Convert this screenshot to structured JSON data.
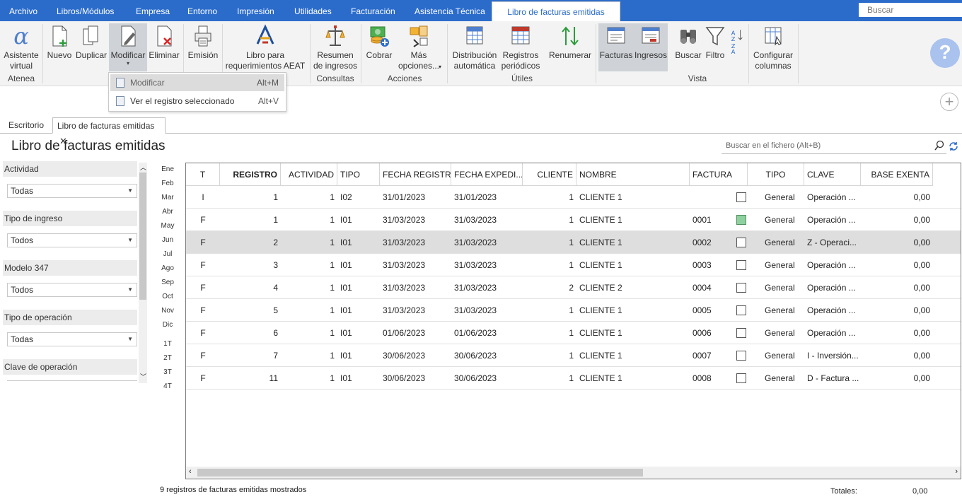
{
  "menubar": {
    "tabs": [
      "Archivo",
      "Libros/Módulos",
      "Empresa",
      "Entorno",
      "Impresión",
      "Utilidades",
      "Facturación",
      "Asistencia Técnica"
    ],
    "active_tab": "Libro de facturas emitidas",
    "search_placeholder": "Buscar"
  },
  "ribbon": {
    "buttons": {
      "asistente": "Asistente virtual",
      "nuevo": "Nuevo",
      "duplicar": "Duplicar",
      "modificar": "Modificar",
      "eliminar": "Eliminar",
      "emision": "Emisión",
      "libro": "Libro para requerimientos AEAT",
      "resumen": "Resumen de ingresos",
      "cobrar": "Cobrar",
      "mas": "Más opciones...",
      "distribucion": "Distribución automática",
      "registros": "Registros periódicos",
      "renumerar": "Renumerar",
      "facturas": "Facturas",
      "ingresos": "Ingresos",
      "buscar": "Buscar",
      "filtro": "Filtro",
      "configurar": "Configurar columnas"
    },
    "groups": {
      "atenea": "Atenea",
      "consultas": "Consultas",
      "acciones": "Acciones",
      "utiles": "Útiles",
      "vista": "Vista"
    }
  },
  "dropdown": {
    "items": [
      {
        "label": "Modificar",
        "shortcut": "Alt+M"
      },
      {
        "label": "Ver el registro seleccionado",
        "shortcut": "Alt+V"
      }
    ]
  },
  "doc_tabs": {
    "escritorio": "Escritorio",
    "libro": "Libro de facturas emitidas"
  },
  "page": {
    "title": "Libro de facturas emitidas",
    "search_placeholder": "Buscar en el fichero (Alt+B)"
  },
  "filters": [
    {
      "label": "Actividad",
      "value": "Todas"
    },
    {
      "label": "Tipo de ingreso",
      "value": "Todos"
    },
    {
      "label": "Modelo 347",
      "value": "Todos"
    },
    {
      "label": "Tipo de operación",
      "value": "Todas"
    },
    {
      "label": "Clave de operación",
      "value": ""
    }
  ],
  "months": [
    "Ene",
    "Feb",
    "Mar",
    "Abr",
    "May",
    "Jun",
    "Jul",
    "Ago",
    "Sep",
    "Oct",
    "Nov",
    "Dic"
  ],
  "quarters": [
    "1T",
    "2T",
    "3T",
    "4T"
  ],
  "table": {
    "headers": [
      "T",
      "REGISTRO",
      "ACTIVIDAD",
      "TIPO",
      "FECHA REGISTRO",
      "FECHA EXPEDI...",
      "CLIENTE",
      "NOMBRE",
      "FACTURA",
      "TIPO",
      "CLAVE",
      "BASE EXENTA"
    ],
    "rows": [
      {
        "t": "I",
        "registro": "1",
        "actividad": "1",
        "tipo": "I02",
        "fecha_reg": "31/01/2023",
        "fecha_exp": "31/01/2023",
        "cliente": "1",
        "nombre": "CLIENTE 1",
        "factura": "",
        "checked": false,
        "tipo2": "General",
        "clave": "Operación ...",
        "base": "0,00"
      },
      {
        "t": "F",
        "registro": "1",
        "actividad": "1",
        "tipo": "I01",
        "fecha_reg": "31/03/2023",
        "fecha_exp": "31/03/2023",
        "cliente": "1",
        "nombre": "CLIENTE 1",
        "factura": "0001",
        "checked": true,
        "tipo2": "General",
        "clave": "Operación ...",
        "base": "0,00"
      },
      {
        "t": "F",
        "registro": "2",
        "actividad": "1",
        "tipo": "I01",
        "fecha_reg": "31/03/2023",
        "fecha_exp": "31/03/2023",
        "cliente": "1",
        "nombre": "CLIENTE 1",
        "factura": "0002",
        "checked": false,
        "tipo2": "General",
        "clave": "Z - Operaci...",
        "base": "0,00"
      },
      {
        "t": "F",
        "registro": "3",
        "actividad": "1",
        "tipo": "I01",
        "fecha_reg": "31/03/2023",
        "fecha_exp": "31/03/2023",
        "cliente": "1",
        "nombre": "CLIENTE 1",
        "factura": "0003",
        "checked": false,
        "tipo2": "General",
        "clave": "Operación ...",
        "base": "0,00"
      },
      {
        "t": "F",
        "registro": "4",
        "actividad": "1",
        "tipo": "I01",
        "fecha_reg": "31/03/2023",
        "fecha_exp": "31/03/2023",
        "cliente": "2",
        "nombre": "CLIENTE 2",
        "factura": "0004",
        "checked": false,
        "tipo2": "General",
        "clave": "Operación ...",
        "base": "0,00"
      },
      {
        "t": "F",
        "registro": "5",
        "actividad": "1",
        "tipo": "I01",
        "fecha_reg": "31/03/2023",
        "fecha_exp": "31/03/2023",
        "cliente": "1",
        "nombre": "CLIENTE 1",
        "factura": "0005",
        "checked": false,
        "tipo2": "General",
        "clave": "Operación ...",
        "base": "0,00"
      },
      {
        "t": "F",
        "registro": "6",
        "actividad": "1",
        "tipo": "I01",
        "fecha_reg": "01/06/2023",
        "fecha_exp": "01/06/2023",
        "cliente": "1",
        "nombre": "CLIENTE 1",
        "factura": "0006",
        "checked": false,
        "tipo2": "General",
        "clave": "Operación ...",
        "base": "0,00"
      },
      {
        "t": "F",
        "registro": "7",
        "actividad": "1",
        "tipo": "I01",
        "fecha_reg": "30/06/2023",
        "fecha_exp": "30/06/2023",
        "cliente": "1",
        "nombre": "CLIENTE 1",
        "factura": "0007",
        "checked": false,
        "tipo2": "General",
        "clave": "I - Inversión...",
        "base": "0,00"
      },
      {
        "t": "F",
        "registro": "11",
        "actividad": "1",
        "tipo": "I01",
        "fecha_reg": "30/06/2023",
        "fecha_exp": "30/06/2023",
        "cliente": "1",
        "nombre": "CLIENTE 1",
        "factura": "0008",
        "checked": false,
        "tipo2": "General",
        "clave": "D - Factura ...",
        "base": "0,00"
      }
    ],
    "selected_row": 2
  },
  "status": {
    "text": "9 registros de facturas emitidas mostrados",
    "totales_label": "Totales:",
    "totales_value": "0,00"
  },
  "colors": {
    "menubar": "#2b6ccb",
    "selected_row": "#dedede",
    "checkbox_on": "#8fd19e"
  }
}
